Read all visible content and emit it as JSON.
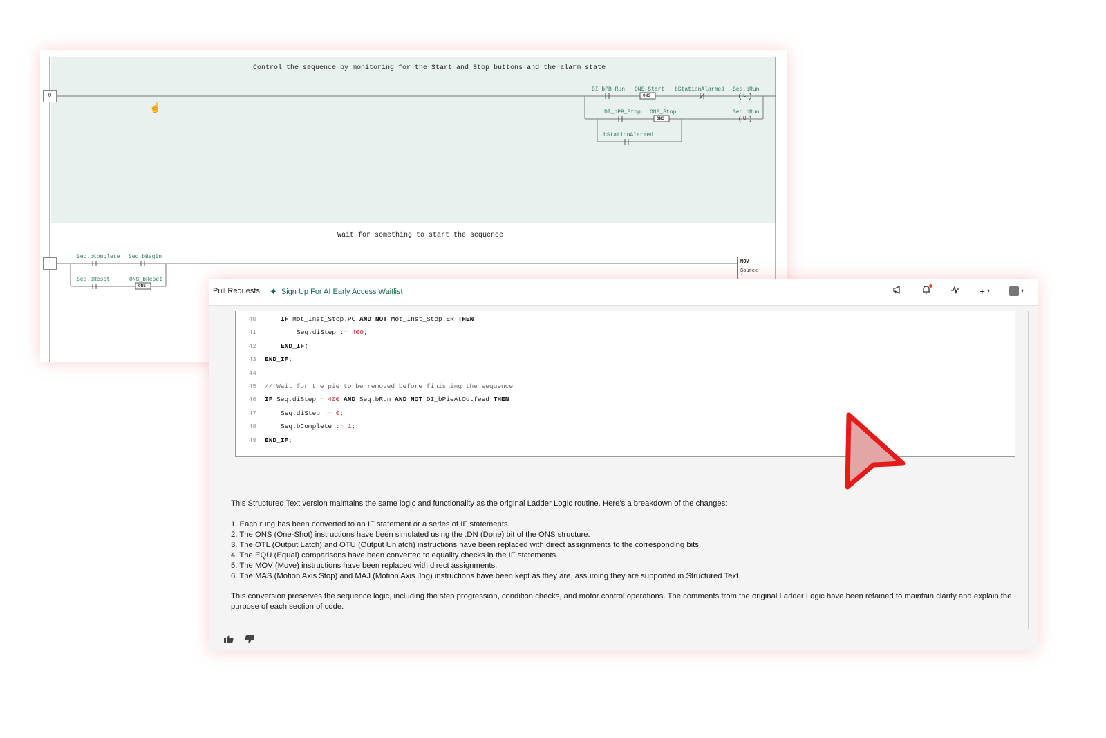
{
  "ladder": {
    "rung0_comment": "Control the sequence by monitoring for the Start and Stop buttons and the alarm state",
    "rung0_number": "0",
    "rung0_tags": [
      "DI_bPB_Run",
      "ONS_Start",
      "bStationAlarmed",
      "Seq.bRun",
      "DI_bPB_Stop",
      "ONS_Stop",
      "Seq.bRun",
      "bStationAlarmed"
    ],
    "ons_label": "ONS",
    "latch_label": "L",
    "unlatch_label": "U",
    "rung1_comment": "Wait for something to start the sequence",
    "rung1_number": "1",
    "rung1_tags": [
      "Seq.bComplete",
      "Seq.bBegin",
      "Seq.bReset",
      "ONS_bReset"
    ],
    "mov": {
      "title": "MOV",
      "source_label": "Source",
      "source_value": "1"
    }
  },
  "topbar": {
    "pull_requests": "Pull Requests",
    "ai_waitlist": "Sign Up For AI Early Access Waitlist",
    "icons": [
      "megaphone-icon",
      "bell-icon",
      "activity-icon",
      "plus-icon",
      "avatar-icon"
    ],
    "plus_label": "+",
    "accent": "#1d6a50"
  },
  "code": {
    "lines": [
      {
        "n": "40",
        "indent": 1,
        "parts": [
          {
            "t": "IF ",
            "k": "kw"
          },
          {
            "t": "Mot_Inst_Stop.PC ",
            "k": ""
          },
          {
            "t": "AND NOT ",
            "k": "kw"
          },
          {
            "t": "Mot_Inst_Stop.ER ",
            "k": ""
          },
          {
            "t": "THEN",
            "k": "kw"
          }
        ]
      },
      {
        "n": "41",
        "indent": 2,
        "parts": [
          {
            "t": "Seq.diStep := ",
            "k": ""
          },
          {
            "t": "400",
            "k": "num"
          },
          {
            "t": ";",
            "k": ""
          }
        ]
      },
      {
        "n": "42",
        "indent": 1,
        "parts": [
          {
            "t": "END_IF;",
            "k": "kw"
          }
        ]
      },
      {
        "n": "43",
        "indent": 0,
        "parts": [
          {
            "t": "END_IF;",
            "k": "kw"
          }
        ]
      },
      {
        "n": "44",
        "indent": 0,
        "parts": []
      },
      {
        "n": "45",
        "indent": 0,
        "parts": [
          {
            "t": "// Wait for the pie to be removed before finishing the sequence",
            "k": "cmt"
          }
        ]
      },
      {
        "n": "46",
        "indent": 0,
        "parts": [
          {
            "t": "IF ",
            "k": "kw"
          },
          {
            "t": "Seq.diStep = ",
            "k": ""
          },
          {
            "t": "400",
            "k": "num"
          },
          {
            "t": " ",
            "k": ""
          },
          {
            "t": "AND ",
            "k": "kw"
          },
          {
            "t": "Seq.bRun ",
            "k": ""
          },
          {
            "t": "AND NOT ",
            "k": "kw"
          },
          {
            "t": "DI_bPieAtOutfeed ",
            "k": ""
          },
          {
            "t": "THEN",
            "k": "kw"
          }
        ]
      },
      {
        "n": "47",
        "indent": 1,
        "parts": [
          {
            "t": "Seq.diStep := ",
            "k": ""
          },
          {
            "t": "0",
            "k": "num"
          },
          {
            "t": ";",
            "k": ""
          }
        ]
      },
      {
        "n": "48",
        "indent": 1,
        "parts": [
          {
            "t": "Seq.bComplete := ",
            "k": ""
          },
          {
            "t": "1",
            "k": "num"
          },
          {
            "t": ";",
            "k": ""
          }
        ]
      },
      {
        "n": "49",
        "indent": 0,
        "parts": [
          {
            "t": "END_IF;",
            "k": "kw"
          }
        ]
      }
    ]
  },
  "response": {
    "intro": "This Structured Text version maintains the same logic and functionality as the original Ladder Logic routine. Here's a breakdown of the changes:",
    "items": [
      "1. Each rung has been converted to an IF statement or a series of IF statements.",
      "2. The ONS (One-Shot) instructions have been simulated using the .DN (Done) bit of the ONS structure.",
      "3. The OTL (Output Latch) and OTU (Output Unlatch) instructions have been replaced with direct assignments to the corresponding bits.",
      "4. The EQU (Equal) comparisons have been converted to equality checks in the IF statements.",
      "5. The MOV (Move) instructions have been replaced with direct assignments.",
      "6. The MAS (Motion Axis Stop) and MAJ (Motion Axis Jog) instructions have been kept as they are, assuming they are supported in Structured Text."
    ],
    "outro": "This conversion preserves the sequence logic, including the step progression, condition checks, and motor control operations. The comments from the original Ladder Logic have been retained to maintain clarity and explain the purpose of each section of code."
  },
  "feedback": {
    "icons": [
      "thumbs-up-icon",
      "thumbs-down-icon"
    ]
  },
  "colors": {
    "pointer": "#e31b1b",
    "rung_highlight": "#e9f1ef",
    "tag_green": "#2f7a5a"
  }
}
